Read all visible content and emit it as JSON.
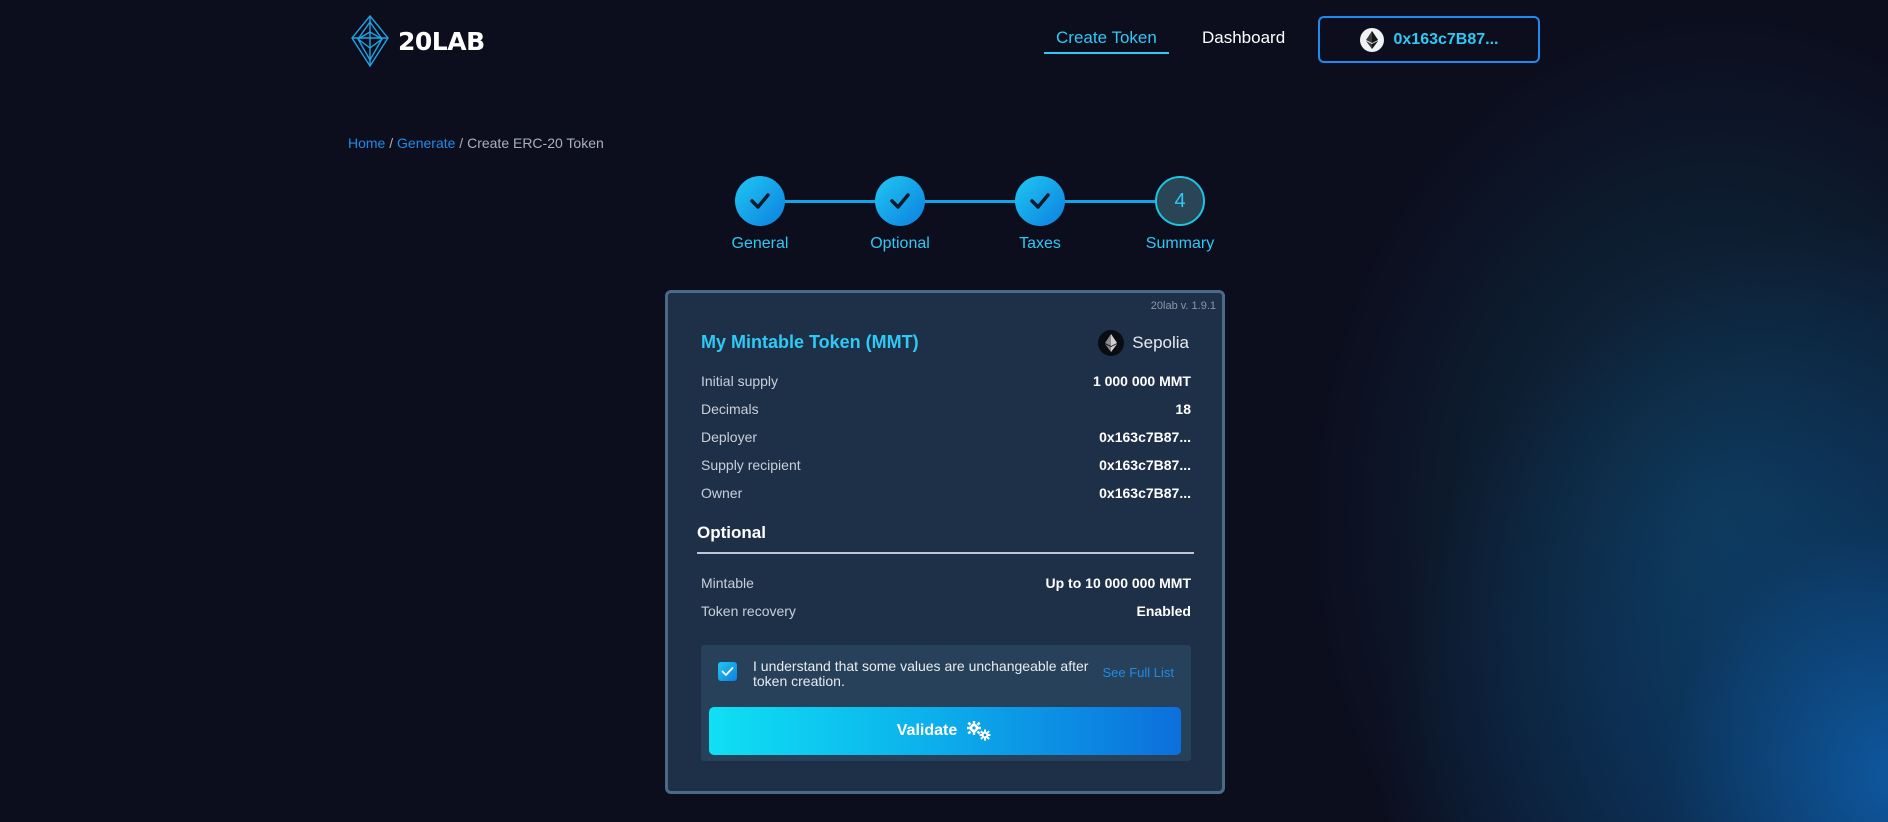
{
  "header": {
    "logo_text": "20LAB",
    "nav": {
      "create_token": "Create Token",
      "dashboard": "Dashboard"
    },
    "wallet": {
      "address": "0x163c7B87..."
    }
  },
  "breadcrumb": {
    "home": "Home",
    "sep": "/",
    "generate": "Generate",
    "current": "Create ERC-20 Token"
  },
  "stepper": {
    "steps": [
      {
        "label": "General",
        "state": "done"
      },
      {
        "label": "Optional",
        "state": "done"
      },
      {
        "label": "Taxes",
        "state": "done"
      },
      {
        "label": "Summary",
        "state": "current",
        "number": "4"
      }
    ]
  },
  "card": {
    "version": "20lab v. 1.9.1",
    "token_title": "My Mintable Token (MMT)",
    "network": "Sepolia",
    "rows": [
      {
        "key": "Initial supply",
        "value": "1 000 000 MMT"
      },
      {
        "key": "Decimals",
        "value": "18"
      },
      {
        "key": "Deployer",
        "value": "0x163c7B87..."
      },
      {
        "key": "Supply recipient",
        "value": "0x163c7B87..."
      },
      {
        "key": "Owner",
        "value": "0x163c7B87..."
      }
    ],
    "optional": {
      "title": "Optional",
      "rows": [
        {
          "key": "Mintable",
          "value": "Up to 10 000 000 MMT"
        },
        {
          "key": "Token recovery",
          "value": "Enabled"
        }
      ]
    },
    "agree": {
      "checked": true,
      "text": "I understand that some values are unchangeable after token creation.",
      "link": "See Full List"
    },
    "validate_label": "Validate"
  },
  "colors": {
    "accent": "#2ec9f5",
    "link": "#1e8be8",
    "background": "#0c0d1d",
    "card": "#1e3048"
  }
}
